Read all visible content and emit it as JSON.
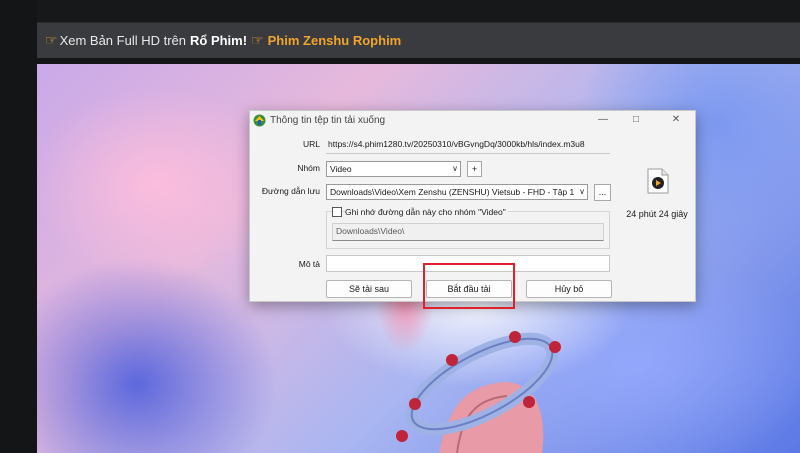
{
  "banner": {
    "part1": "Xem Bản Full HD trên",
    "part2": "Rổ Phim!",
    "part3": "Phim Zenshu Rophim"
  },
  "dialog": {
    "title": "Thông tin tệp tin tải xuống",
    "url_label": "URL",
    "url_value": "https://s4.phim1280.tv/20250310/vBGvngDq/3000kb/hls/index.m3u8",
    "group_label": "Nhóm",
    "group_value": "Video",
    "add_group_label": "+",
    "path_label": "Đường dẫn lưu",
    "path_value": "Downloads\\Video\\Xem Zenshu (ZENSHU) Vietsub - FHD - Tập 1",
    "browse_label": "...",
    "remember_label": "Ghi nhớ đường dẫn này cho nhóm \"Video\"",
    "remember_path": "Downloads\\Video\\",
    "description_label": "Mô tả",
    "description_value": "",
    "duration": "24 phút 24 giây",
    "buttons": {
      "later": "Sẽ tải sau",
      "start": "Bắt đầu tải",
      "cancel": "Hủy bỏ"
    }
  },
  "colors": {
    "accent_orange": "#f0a52a",
    "highlight_red": "#e0212b"
  }
}
